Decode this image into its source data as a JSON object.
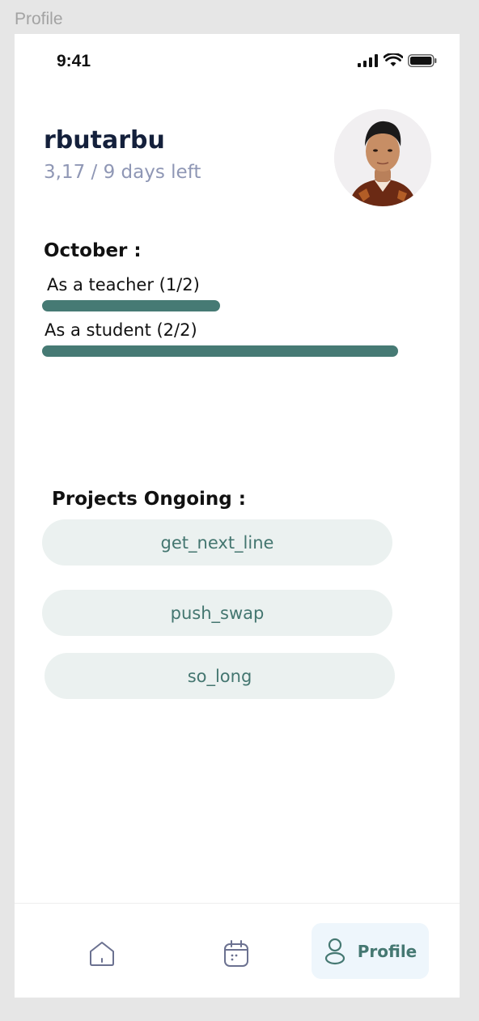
{
  "frame": {
    "label": "Profile"
  },
  "status_bar": {
    "time": "9:41"
  },
  "profile": {
    "username": "rbutarbu",
    "subtitle": "3,17 / 9 days left"
  },
  "evaluations": {
    "month_title": "October :",
    "items": [
      {
        "label": "As a teacher (1/2)",
        "progress": 0.5
      },
      {
        "label": "As a student (2/2)",
        "progress": 1.0
      }
    ]
  },
  "projects": {
    "title": "Projects Ongoing :",
    "items": [
      "get_next_line",
      "push_swap",
      "so_long"
    ]
  },
  "tab_bar": {
    "items": [
      {
        "icon": "home-icon",
        "label": ""
      },
      {
        "icon": "calendar-icon",
        "label": ""
      },
      {
        "icon": "user-icon",
        "label": "Profile",
        "active": true
      }
    ]
  },
  "colors": {
    "accent": "#467a74",
    "pill_bg": "#ebf1f0",
    "active_tab_bg": "#eef6fc",
    "subtitle": "#8f97b5"
  }
}
